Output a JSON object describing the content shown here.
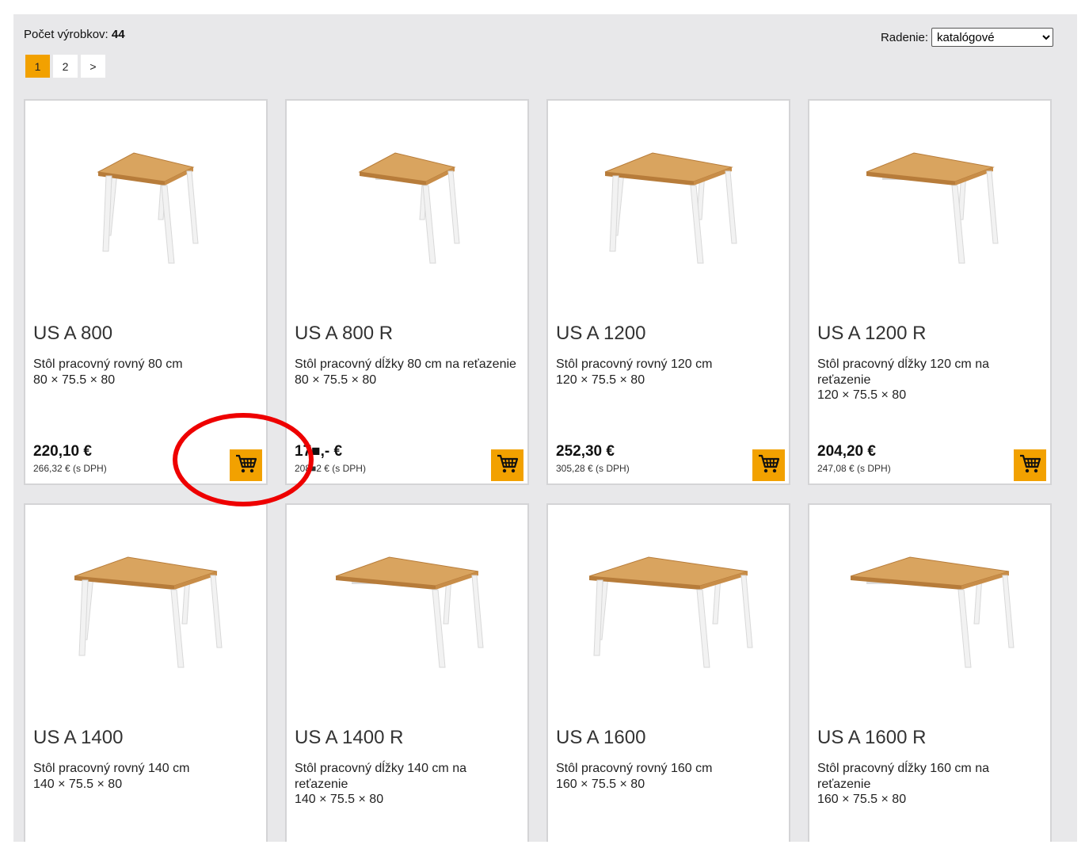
{
  "header": {
    "count_label": "Počet výrobkov:",
    "count_value": "44",
    "sort_label": "Radenie:",
    "sort_selected": "katalógové"
  },
  "pagination": {
    "pages": [
      "1",
      "2"
    ],
    "next": ">",
    "current": "1"
  },
  "colors": {
    "accent": "#f2a100",
    "background": "#e8e8ea",
    "highlight": "#ee0000"
  },
  "products": [
    {
      "name": "US A 800",
      "desc": "Stôl pracovný rovný 80 cm",
      "dims": "80 × 75.5 × 80",
      "price": "220,10 €",
      "price_vat": "266,32 € (s DPH)"
    },
    {
      "name": "US A 800 R",
      "desc": "Stôl pracovný dĺžky 80 cm na reťazenie",
      "dims": "80 × 75.5 × 80",
      "price": "17■,- €",
      "price_vat": "208■2 € (s DPH)"
    },
    {
      "name": "US A 1200",
      "desc": "Stôl pracovný rovný 120 cm",
      "dims": "120 × 75.5 × 80",
      "price": "252,30 €",
      "price_vat": "305,28 € (s DPH)"
    },
    {
      "name": "US A 1200 R",
      "desc": "Stôl pracovný dĺžky 120 cm na reťazenie",
      "dims": "120 × 75.5 × 80",
      "price": "204,20 €",
      "price_vat": "247,08 € (s DPH)"
    },
    {
      "name": "US A 1400",
      "desc": "Stôl pracovný rovný 140 cm",
      "dims": "140 × 75.5 × 80",
      "price": "",
      "price_vat": ""
    },
    {
      "name": "US A 1400 R",
      "desc": "Stôl pracovný dĺžky 140 cm na reťazenie",
      "dims": "140 × 75.5 × 80",
      "price": "",
      "price_vat": ""
    },
    {
      "name": "US A 1600",
      "desc": "Stôl pracovný rovný 160 cm",
      "dims": "160 × 75.5 × 80",
      "price": "",
      "price_vat": ""
    },
    {
      "name": "US A 1600 R",
      "desc": "Stôl pracovný dĺžky 160 cm na reťazenie",
      "dims": "160 × 75.5 × 80",
      "price": "",
      "price_vat": ""
    }
  ],
  "icons": {
    "cart": "shopping-cart-icon",
    "product": "desk-image"
  }
}
